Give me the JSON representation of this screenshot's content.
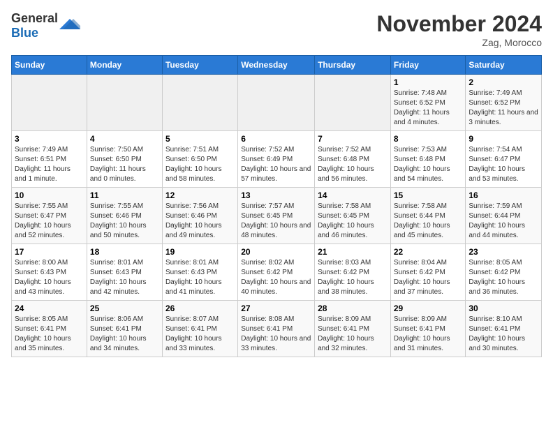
{
  "logo": {
    "text_general": "General",
    "text_blue": "Blue"
  },
  "title": "November 2024",
  "location": "Zag, Morocco",
  "weekdays": [
    "Sunday",
    "Monday",
    "Tuesday",
    "Wednesday",
    "Thursday",
    "Friday",
    "Saturday"
  ],
  "weeks": [
    [
      {
        "day": "",
        "info": ""
      },
      {
        "day": "",
        "info": ""
      },
      {
        "day": "",
        "info": ""
      },
      {
        "day": "",
        "info": ""
      },
      {
        "day": "",
        "info": ""
      },
      {
        "day": "1",
        "info": "Sunrise: 7:48 AM\nSunset: 6:52 PM\nDaylight: 11 hours and 4 minutes."
      },
      {
        "day": "2",
        "info": "Sunrise: 7:49 AM\nSunset: 6:52 PM\nDaylight: 11 hours and 3 minutes."
      }
    ],
    [
      {
        "day": "3",
        "info": "Sunrise: 7:49 AM\nSunset: 6:51 PM\nDaylight: 11 hours and 1 minute."
      },
      {
        "day": "4",
        "info": "Sunrise: 7:50 AM\nSunset: 6:50 PM\nDaylight: 11 hours and 0 minutes."
      },
      {
        "day": "5",
        "info": "Sunrise: 7:51 AM\nSunset: 6:50 PM\nDaylight: 10 hours and 58 minutes."
      },
      {
        "day": "6",
        "info": "Sunrise: 7:52 AM\nSunset: 6:49 PM\nDaylight: 10 hours and 57 minutes."
      },
      {
        "day": "7",
        "info": "Sunrise: 7:52 AM\nSunset: 6:48 PM\nDaylight: 10 hours and 56 minutes."
      },
      {
        "day": "8",
        "info": "Sunrise: 7:53 AM\nSunset: 6:48 PM\nDaylight: 10 hours and 54 minutes."
      },
      {
        "day": "9",
        "info": "Sunrise: 7:54 AM\nSunset: 6:47 PM\nDaylight: 10 hours and 53 minutes."
      }
    ],
    [
      {
        "day": "10",
        "info": "Sunrise: 7:55 AM\nSunset: 6:47 PM\nDaylight: 10 hours and 52 minutes."
      },
      {
        "day": "11",
        "info": "Sunrise: 7:55 AM\nSunset: 6:46 PM\nDaylight: 10 hours and 50 minutes."
      },
      {
        "day": "12",
        "info": "Sunrise: 7:56 AM\nSunset: 6:46 PM\nDaylight: 10 hours and 49 minutes."
      },
      {
        "day": "13",
        "info": "Sunrise: 7:57 AM\nSunset: 6:45 PM\nDaylight: 10 hours and 48 minutes."
      },
      {
        "day": "14",
        "info": "Sunrise: 7:58 AM\nSunset: 6:45 PM\nDaylight: 10 hours and 46 minutes."
      },
      {
        "day": "15",
        "info": "Sunrise: 7:58 AM\nSunset: 6:44 PM\nDaylight: 10 hours and 45 minutes."
      },
      {
        "day": "16",
        "info": "Sunrise: 7:59 AM\nSunset: 6:44 PM\nDaylight: 10 hours and 44 minutes."
      }
    ],
    [
      {
        "day": "17",
        "info": "Sunrise: 8:00 AM\nSunset: 6:43 PM\nDaylight: 10 hours and 43 minutes."
      },
      {
        "day": "18",
        "info": "Sunrise: 8:01 AM\nSunset: 6:43 PM\nDaylight: 10 hours and 42 minutes."
      },
      {
        "day": "19",
        "info": "Sunrise: 8:01 AM\nSunset: 6:43 PM\nDaylight: 10 hours and 41 minutes."
      },
      {
        "day": "20",
        "info": "Sunrise: 8:02 AM\nSunset: 6:42 PM\nDaylight: 10 hours and 40 minutes."
      },
      {
        "day": "21",
        "info": "Sunrise: 8:03 AM\nSunset: 6:42 PM\nDaylight: 10 hours and 38 minutes."
      },
      {
        "day": "22",
        "info": "Sunrise: 8:04 AM\nSunset: 6:42 PM\nDaylight: 10 hours and 37 minutes."
      },
      {
        "day": "23",
        "info": "Sunrise: 8:05 AM\nSunset: 6:42 PM\nDaylight: 10 hours and 36 minutes."
      }
    ],
    [
      {
        "day": "24",
        "info": "Sunrise: 8:05 AM\nSunset: 6:41 PM\nDaylight: 10 hours and 35 minutes."
      },
      {
        "day": "25",
        "info": "Sunrise: 8:06 AM\nSunset: 6:41 PM\nDaylight: 10 hours and 34 minutes."
      },
      {
        "day": "26",
        "info": "Sunrise: 8:07 AM\nSunset: 6:41 PM\nDaylight: 10 hours and 33 minutes."
      },
      {
        "day": "27",
        "info": "Sunrise: 8:08 AM\nSunset: 6:41 PM\nDaylight: 10 hours and 33 minutes."
      },
      {
        "day": "28",
        "info": "Sunrise: 8:09 AM\nSunset: 6:41 PM\nDaylight: 10 hours and 32 minutes."
      },
      {
        "day": "29",
        "info": "Sunrise: 8:09 AM\nSunset: 6:41 PM\nDaylight: 10 hours and 31 minutes."
      },
      {
        "day": "30",
        "info": "Sunrise: 8:10 AM\nSunset: 6:41 PM\nDaylight: 10 hours and 30 minutes."
      }
    ]
  ]
}
